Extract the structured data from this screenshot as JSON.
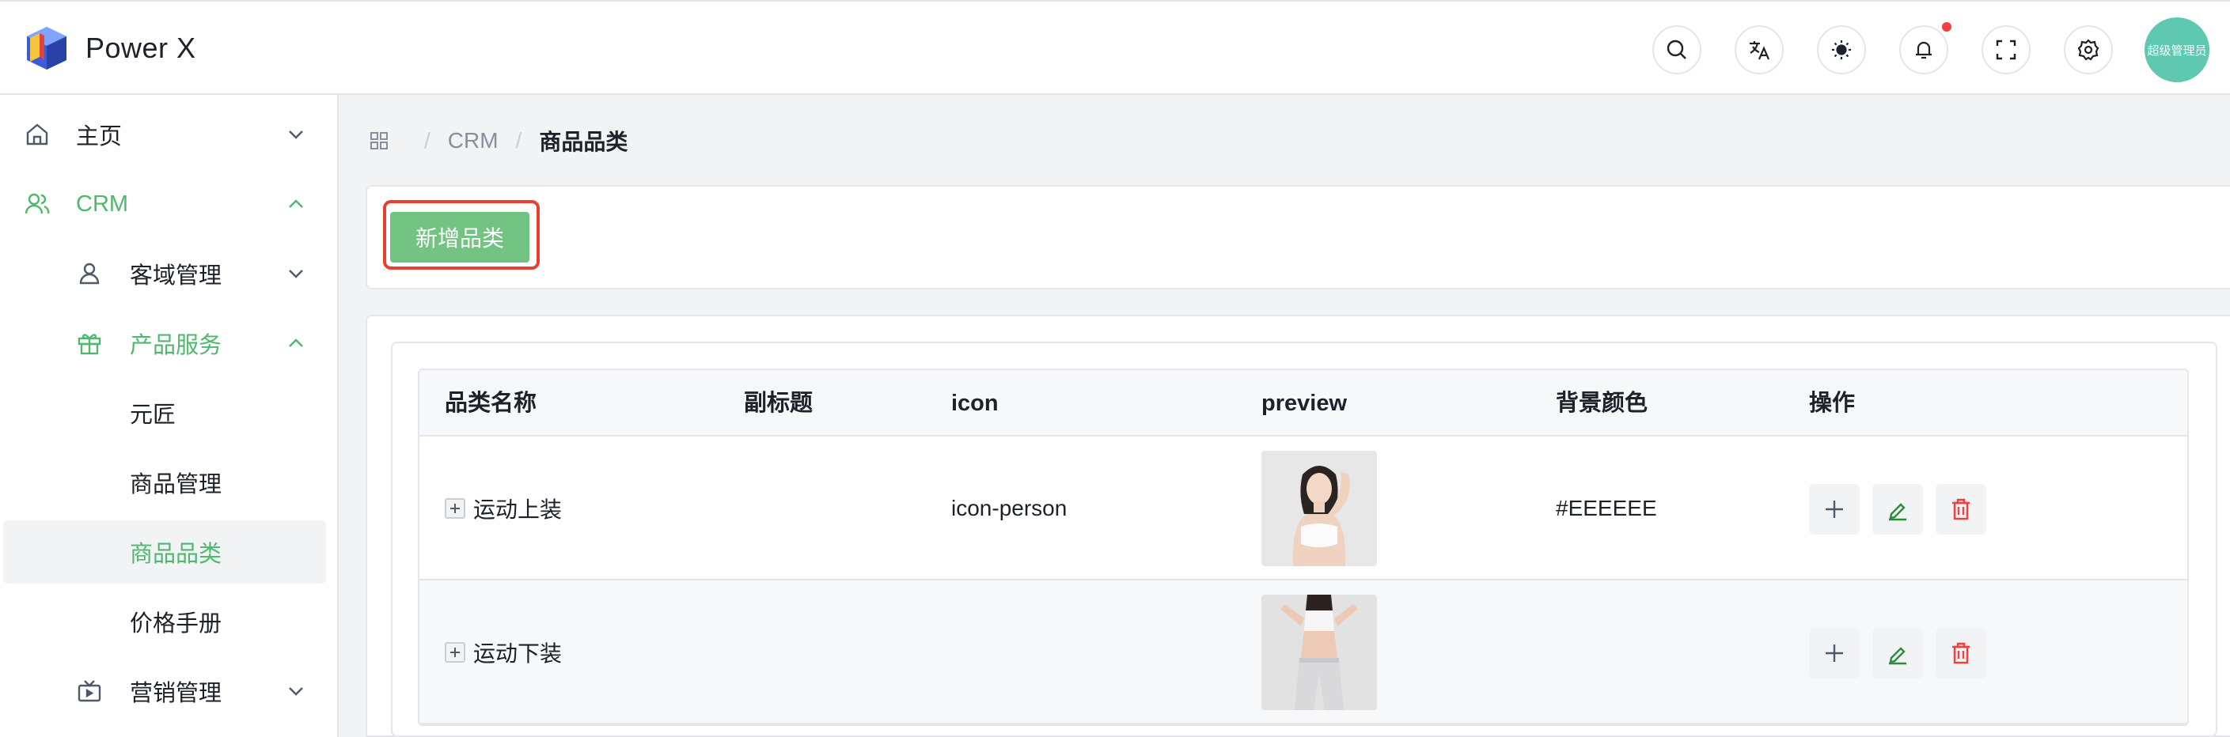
{
  "app": {
    "title": "Power X",
    "avatar_text": "超级管理员"
  },
  "header_icons": [
    "search-icon",
    "translate-icon",
    "theme-sun-icon",
    "bell-icon",
    "fullscreen-icon",
    "settings-gear-icon"
  ],
  "colors": {
    "accent": "#4fb86d",
    "button": "#73c383",
    "danger": "#f53f3f",
    "avatar": "#5ec8b0"
  },
  "sidebar": {
    "items": [
      {
        "label": "主页",
        "icon": "home-icon",
        "expanded": false
      },
      {
        "label": "CRM",
        "icon": "users-icon",
        "expanded": true
      },
      {
        "label": "客域管理",
        "icon": "user-icon",
        "expanded": false
      },
      {
        "label": "产品服务",
        "icon": "gift-icon",
        "expanded": true
      },
      {
        "label": "元匠"
      },
      {
        "label": "商品管理"
      },
      {
        "label": "商品品类",
        "active": true
      },
      {
        "label": "价格手册"
      },
      {
        "label": "营销管理",
        "icon": "tv-icon",
        "expanded": false
      }
    ]
  },
  "breadcrumb": {
    "items": [
      "CRM",
      "商品品类"
    ]
  },
  "toolbar": {
    "add_label": "新增品类"
  },
  "table": {
    "columns": [
      "品类名称",
      "副标题",
      "icon",
      "preview",
      "背景颜色",
      "操作"
    ],
    "rows": [
      {
        "name": "运动上装",
        "subtitle": "",
        "icon": "icon-person",
        "preview": "top-photo",
        "bg_color": "#EEEEEE"
      },
      {
        "name": "运动下装",
        "subtitle": "",
        "icon": "",
        "preview": "bottom-photo",
        "bg_color": ""
      }
    ]
  }
}
